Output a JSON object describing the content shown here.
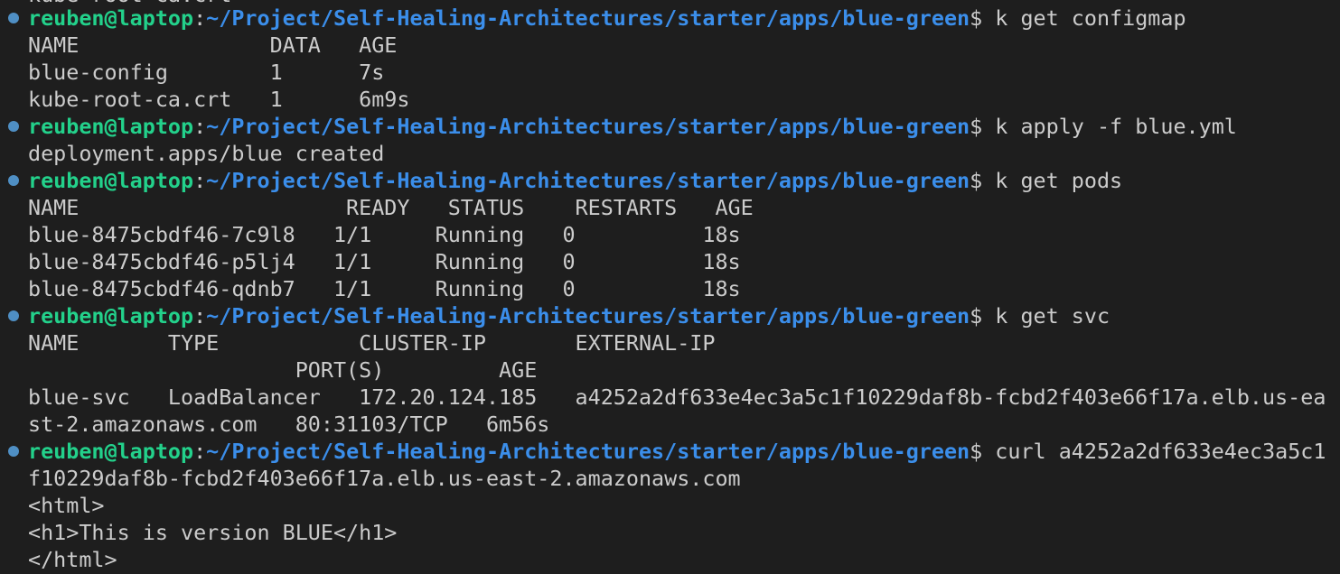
{
  "terminal": {
    "prompt": {
      "user_host": "reuben@laptop",
      "separator": ":",
      "path": "~/Project/Self-Healing-Architectures/starter/apps/blue-green",
      "symbol": "$ "
    },
    "colors": {
      "background": "#1e1e1e",
      "text": "#cccccc",
      "user_host": "#23d18b",
      "path": "#3b8eea",
      "marker": "#4f8fc4"
    },
    "top_partial": "kube-root-ca.crt",
    "commands": [
      {
        "cmd": "k get configmap"
      },
      {
        "cmd": "k apply -f blue.yml"
      },
      {
        "cmd": "k get pods"
      },
      {
        "cmd": "k get svc"
      },
      {
        "cmd": "curl a4252a2df633e4ec3a5c1"
      }
    ],
    "output": {
      "configmap": [
        "NAME               DATA   AGE",
        "blue-config        1      7s",
        "kube-root-ca.crt   1      6m9s"
      ],
      "apply": [
        "deployment.apps/blue created"
      ],
      "pods": [
        "NAME                     READY   STATUS    RESTARTS   AGE",
        "blue-8475cbdf46-7c9l8   1/1     Running   0          18s",
        "blue-8475cbdf46-p5lj4   1/1     Running   0          18s",
        "blue-8475cbdf46-qdnb7   1/1     Running   0          18s"
      ],
      "svc": [
        "NAME       TYPE           CLUSTER-IP       EXTERNAL-IP",
        "                     PORT(S)         AGE",
        "blue-svc   LoadBalancer   172.20.124.185   a4252a2df633e4ec3a5c1f10229daf8b-fcbd2f403e66f17a.elb.us-ea",
        "st-2.amazonaws.com   80:31103/TCP   6m56s"
      ],
      "curl": [
        "f10229daf8b-fcbd2f403e66f17a.elb.us-east-2.amazonaws.com",
        "<html>",
        "<h1>This is version BLUE</h1>",
        "</html>"
      ]
    }
  }
}
